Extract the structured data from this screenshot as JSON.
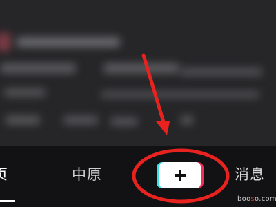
{
  "bottom_nav": {
    "home": {
      "label": "页"
    },
    "zhongyuan": {
      "label": "中原"
    },
    "create": {
      "icon": "plus-icon"
    },
    "messages": {
      "label": "消息"
    }
  },
  "annotation": {
    "color": "#e8231f",
    "target": "create-button"
  },
  "colors": {
    "accent_cyan": "#34e3e6",
    "accent_pink": "#f12d59",
    "tab_bar": "#121214"
  },
  "watermark": {
    "prefix": "boo",
    "dot": "s",
    "suffix": "o.com"
  }
}
